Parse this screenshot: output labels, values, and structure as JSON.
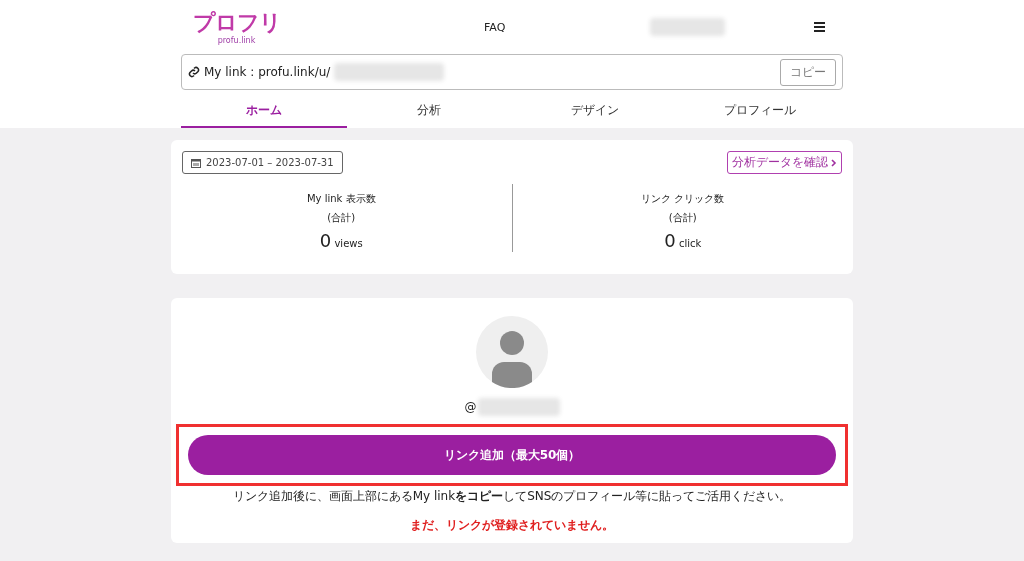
{
  "header": {
    "logo": "プロフリ",
    "logo_sub": "profu.link",
    "nav": "FAQ"
  },
  "mylink": {
    "label": "My link : profu.link/u/",
    "copy": "コピー"
  },
  "tabs": [
    {
      "label": "ホーム",
      "selected": true
    },
    {
      "label": "分析",
      "selected": false
    },
    {
      "label": "デザイン",
      "selected": false
    },
    {
      "label": "プロフィール",
      "selected": false
    }
  ],
  "stats": {
    "date_range": "2023-07-01 – 2023-07-31",
    "detail_link": "分析データを確認",
    "items": [
      {
        "title": "My link 表示数",
        "sub": "(合計)",
        "value": "0",
        "unit": "views"
      },
      {
        "title": "リンク クリック数",
        "sub": "(合計)",
        "value": "0",
        "unit": "click"
      }
    ]
  },
  "profile": {
    "handle": "@",
    "add_button": "リンク追加（最大50個）",
    "highlighted": true,
    "hint": "リンク追加後に、画面上部にあるMy link**をコピー**してSNSのプロフィール等に貼ってご活用ください。",
    "empty": "まだ、リンクが登録されていません。"
  }
}
